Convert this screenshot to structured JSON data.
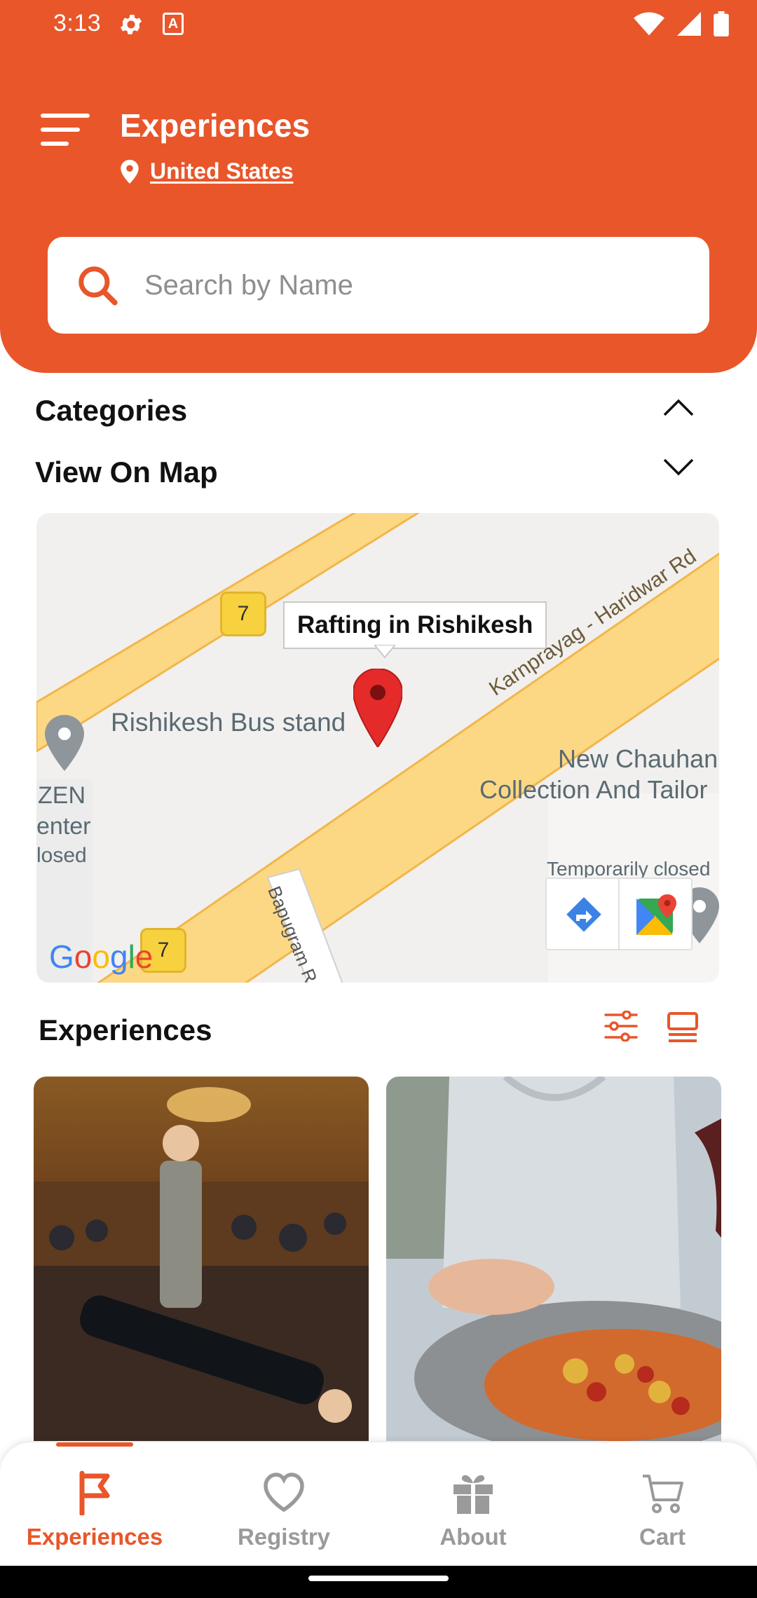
{
  "status_bar": {
    "time": "3:13"
  },
  "header": {
    "title": "Experiences",
    "location": "United States"
  },
  "search": {
    "placeholder": "Search by Name",
    "value": ""
  },
  "sections": {
    "categories": "Categories",
    "view_on_map": "View On Map"
  },
  "map": {
    "callout": "Rafting in Rishikesh",
    "labels": {
      "bus_stand": "Rishikesh Bus stand",
      "road_main": "Karnprayag - Haridwar Rd",
      "road_side": "Bapugram R",
      "shop": "New Chauhan Collection And Tailor",
      "shop_line1": "New Chauhan",
      "shop_line2": "Collection And Tailor",
      "zen_1": "ZEN",
      "zen_2": "enter",
      "zen_3": "losed",
      "temp_closed": "Temporarily closed",
      "shield_top": "7",
      "shield_bottom": "7",
      "google": "Google"
    }
  },
  "experiences": {
    "title": "Experiences"
  },
  "bottom_nav": {
    "items": [
      {
        "label": "Experiences",
        "icon": "flag-icon",
        "active": true
      },
      {
        "label": "Registry",
        "icon": "heart-icon",
        "active": false
      },
      {
        "label": "About",
        "icon": "gift-icon",
        "active": false
      },
      {
        "label": "Cart",
        "icon": "cart-icon",
        "active": false
      }
    ]
  },
  "colors": {
    "accent": "#e8562a",
    "inactive": "#9a9a9a",
    "road": "#fcd885",
    "road_border": "#f2b649",
    "pin": "#e52a2a"
  }
}
